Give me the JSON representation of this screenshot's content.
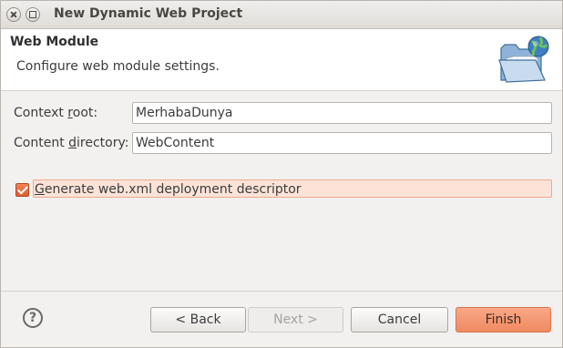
{
  "window": {
    "title": "New Dynamic Web Project"
  },
  "banner": {
    "title": "Web Module",
    "description": "Configure web module settings.",
    "icon": "web-folder-globe-icon"
  },
  "form": {
    "context_root": {
      "label_pre": "Context ",
      "label_mnemonic": "r",
      "label_post": "oot:",
      "value": "MerhabaDunya"
    },
    "content_directory": {
      "label_pre": "Content ",
      "label_mnemonic": "d",
      "label_post": "irectory:",
      "value": "WebContent"
    },
    "generate_descriptor": {
      "checked": true,
      "label_mnemonic": "G",
      "label_post": "enerate web.xml deployment descriptor"
    }
  },
  "buttons": {
    "help_glyph": "?",
    "back": "< Back",
    "next": "Next >",
    "cancel": "Cancel",
    "finish": "Finish"
  },
  "colors": {
    "accent": "#f08a61",
    "checkbox": "#dc5c2f"
  }
}
